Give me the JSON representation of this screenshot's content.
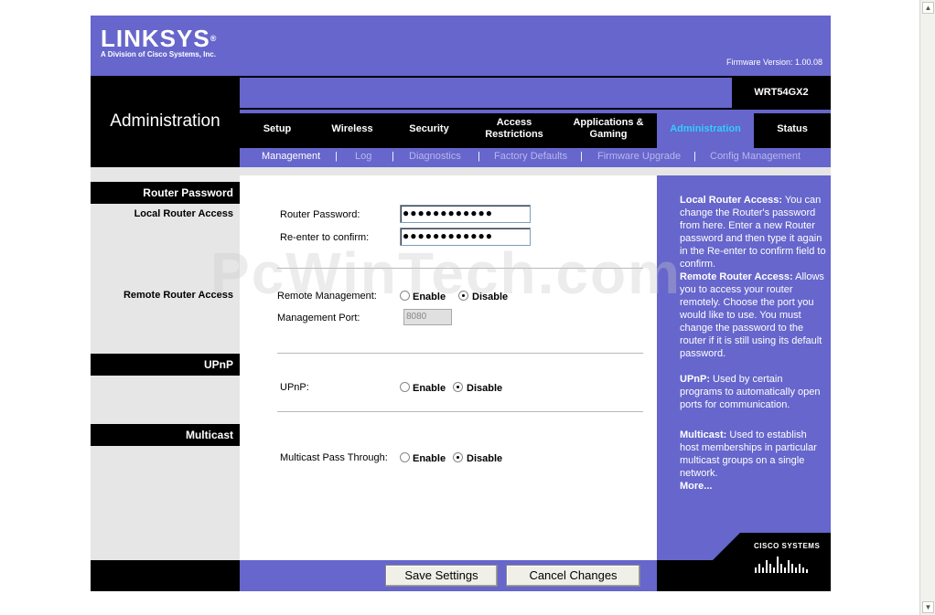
{
  "header": {
    "logo": "LINKSYS",
    "logo_mark": "®",
    "tagline": "A Division of Cisco Systems, Inc.",
    "firmware": "Firmware Version: 1.00.08",
    "model": "WRT54GX2",
    "section_title": "Administration"
  },
  "tabs": [
    {
      "label": "Setup"
    },
    {
      "label": "Wireless"
    },
    {
      "label": "Security"
    },
    {
      "label": "Access Restrictions"
    },
    {
      "label": "Applications & Gaming"
    },
    {
      "label": "Administration",
      "active": true
    },
    {
      "label": "Status"
    }
  ],
  "subnav": [
    {
      "label": "Management",
      "current": true
    },
    {
      "label": "Log"
    },
    {
      "label": "Diagnostics"
    },
    {
      "label": "Factory Defaults"
    },
    {
      "label": "Firmware Upgrade"
    },
    {
      "label": "Config Management"
    }
  ],
  "subnav_sep": "|",
  "left": {
    "router_password": "Router Password",
    "local_access": "Local Router Access",
    "remote_access": "Remote Router Access",
    "upnp": "UPnP",
    "multicast": "Multicast"
  },
  "form": {
    "router_password_label": "Router Password:",
    "router_password_value": "●●●●●●●●●●●●",
    "reenter_label": "Re-enter to confirm:",
    "reenter_value": "●●●●●●●●●●●●",
    "remote_mgmt_label": "Remote Management:",
    "mgmt_port_label": "Management Port:",
    "mgmt_port_value": "8080",
    "upnp_label": "UPnP:",
    "multicast_label": "Multicast Pass Through:",
    "enable": "Enable",
    "disable": "Disable"
  },
  "help": {
    "local_title": "Local Router Access:",
    "local_text": " You can change the Router's password from here. Enter a new Router password and then type it again in the Re-enter to confirm field to confirm.",
    "remote_title": "Remote Router Access:",
    "remote_text": " Allows you to access your router remotely. Choose the port you would like to use. You must change the password to the router if it is still using its default password.",
    "upnp_title": "UPnP:",
    "upnp_text": " Used by certain programs to automatically open ports for communication.",
    "multicast_title": "Multicast:",
    "multicast_text": " Used to establish host memberships in particular multicast groups on a single network.",
    "more": "More..."
  },
  "cisco": "CISCO SYSTEMS",
  "buttons": {
    "save": "Save Settings",
    "cancel": "Cancel Changes"
  },
  "watermark": "PcWinTech.com",
  "colors": {
    "brand_purple": "#6666cc",
    "active_tab_text": "#33ccff"
  }
}
